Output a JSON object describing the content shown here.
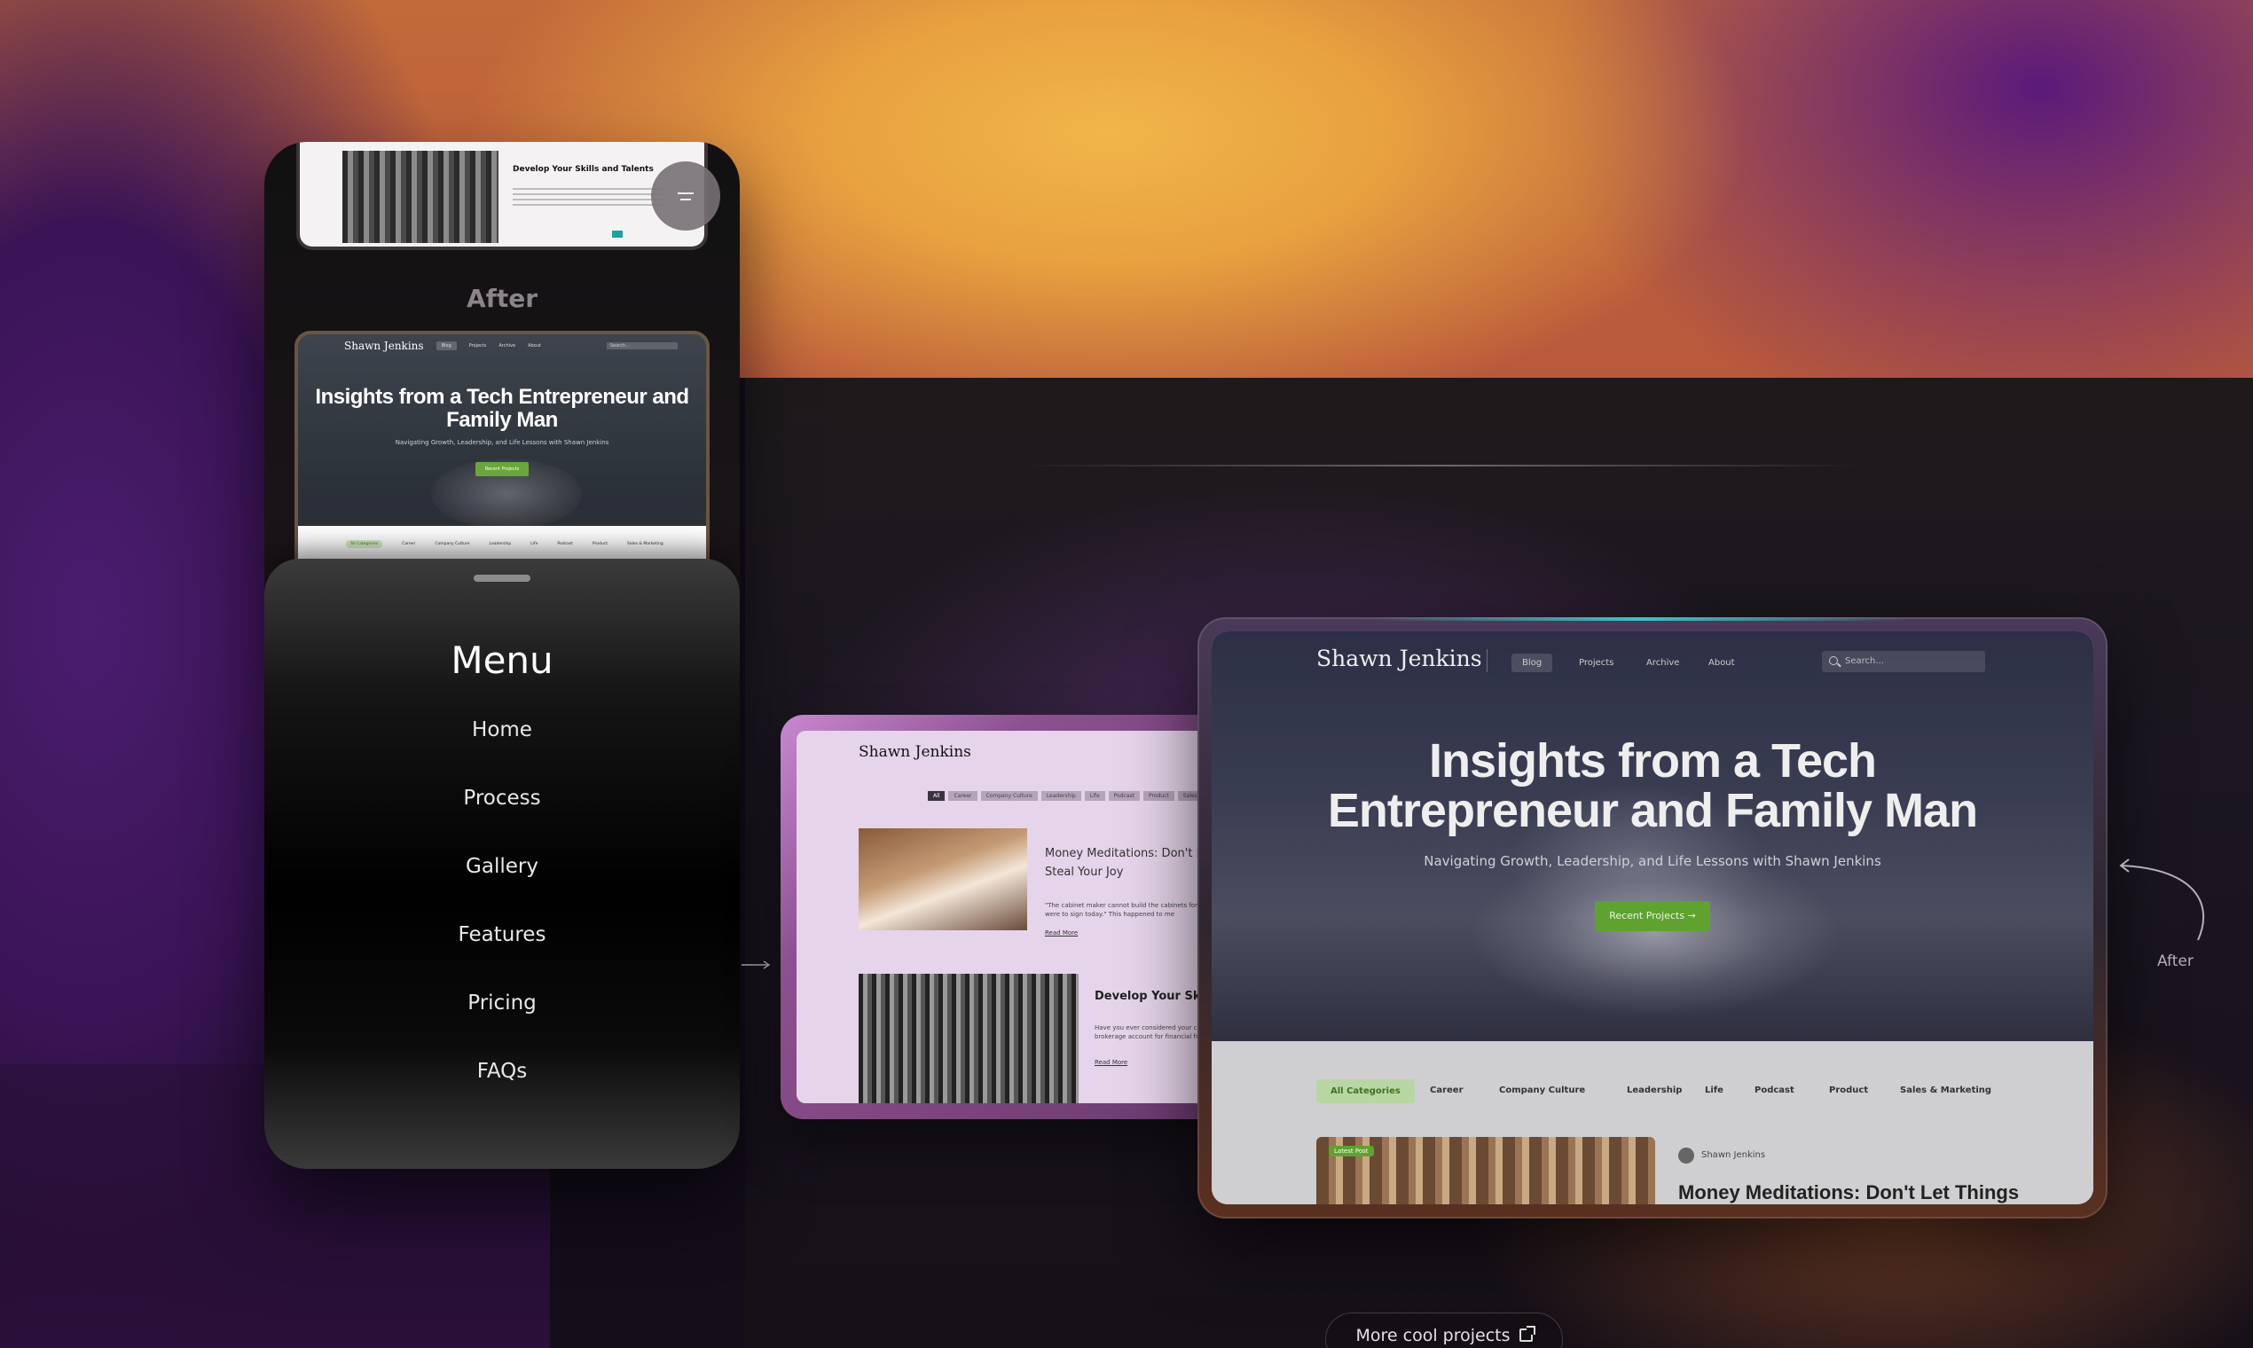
{
  "phone": {
    "top_card": {
      "title": "Develop Your Skills and Talents"
    },
    "after_label": "After",
    "hero_card": {
      "brand": "Shawn Jenkins",
      "nav": [
        "Blog",
        "Projects",
        "Archive",
        "About"
      ],
      "search_placeholder": "Search...",
      "title": "Insights from a Tech Entrepreneur and Family Man",
      "subtitle": "Navigating Growth, Leadership, and Life Lessons with Shawn Jenkins",
      "button": "Recent Projects",
      "categories": [
        "All Categories",
        "Career",
        "Company Culture",
        "Leadership",
        "Life",
        "Podcast",
        "Product",
        "Sales & Marketing"
      ]
    },
    "menu": {
      "title": "Menu",
      "items": [
        "Home",
        "Process",
        "Gallery",
        "Features",
        "Pricing",
        "FAQs"
      ]
    }
  },
  "tablet_mid": {
    "brand": "Shawn Jenkins",
    "categories": [
      "All",
      "Career",
      "Company Culture",
      "Leadership",
      "Life",
      "Podcast",
      "Product",
      "Sales"
    ],
    "post1": {
      "title": "Money Meditations: Don't Let Things Steal Your Joy",
      "excerpt": "\"The cabinet maker cannot build the cabinets for sale that's if we were to sign today.\" This happened to me",
      "read_more": "Read More"
    },
    "post2": {
      "title": "Develop Your Skills and Talents",
      "excerpt": "Have you ever considered your career to be like a brokerage account for financial freedom?",
      "read_more": "Read More"
    }
  },
  "tablet_right": {
    "brand": "Shawn Jenkins",
    "nav": [
      "Blog",
      "Projects",
      "Archive",
      "About"
    ],
    "search_placeholder": "Search...",
    "title_line1": "Insights from a Tech",
    "title_line2": "Entrepreneur and Family Man",
    "subtitle": "Navigating Growth, Leadership, and Life Lessons with Shawn Jenkins",
    "button": "Recent Projects →",
    "categories": [
      "All Categories",
      "Career",
      "Company Culture",
      "Leadership",
      "Life",
      "Podcast",
      "Product",
      "Sales & Marketing"
    ],
    "post_badge": "Latest Post",
    "post_author": "Shawn Jenkins",
    "post_title": "Money Meditations: Don't Let Things"
  },
  "annotations": {
    "after": "After"
  },
  "footer": {
    "more_projects": "More cool projects"
  },
  "colors": {
    "accent_green": "#5fa230",
    "teal": "#1ba3a0"
  }
}
